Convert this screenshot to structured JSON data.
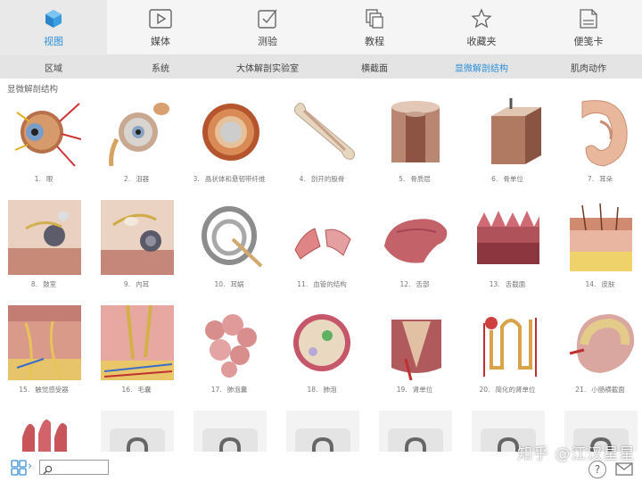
{
  "toptabs": [
    {
      "label": "视图",
      "icon": "cube-icon",
      "active": true
    },
    {
      "label": "媒体",
      "icon": "play-icon",
      "active": false
    },
    {
      "label": "测验",
      "icon": "checkbox-icon",
      "active": false
    },
    {
      "label": "教程",
      "icon": "copy-icon",
      "active": false
    },
    {
      "label": "收藏夹",
      "icon": "star-icon",
      "active": false
    },
    {
      "label": "便笺卡",
      "icon": "note-card-icon",
      "active": false
    }
  ],
  "subtabs": [
    {
      "label": "区域",
      "active": false
    },
    {
      "label": "系统",
      "active": false
    },
    {
      "label": "大体解剖实验室",
      "active": false
    },
    {
      "label": "横截面",
      "active": false
    },
    {
      "label": "显微解剖结构",
      "active": true
    },
    {
      "label": "肌肉动作",
      "active": false
    }
  ],
  "section_title": "显微解剖结构",
  "colors": {
    "accent": "#2d8fd9",
    "topbar": "#f5f5f5",
    "subnav": "#e4e4e4"
  },
  "tiles": [
    {
      "num": "1.",
      "label": "眼",
      "img": "eye"
    },
    {
      "num": "2.",
      "label": "泪器",
      "img": "lacrimal"
    },
    {
      "num": "3.",
      "label": "晶状体和悬韧带纤维",
      "img": "lens"
    },
    {
      "num": "4.",
      "label": "剖开的股骨",
      "img": "femur"
    },
    {
      "num": "5.",
      "label": "骨质层",
      "img": "bone"
    },
    {
      "num": "6.",
      "label": "骨单位",
      "img": "osteon"
    },
    {
      "num": "7.",
      "label": "耳朵",
      "img": "ear"
    },
    {
      "num": "8.",
      "label": "鼓室",
      "img": "tympanic"
    },
    {
      "num": "9.",
      "label": "内耳",
      "img": "innerear"
    },
    {
      "num": "10.",
      "label": "耳蜗",
      "img": "cochlea"
    },
    {
      "num": "11.",
      "label": "血管的结构",
      "img": "vessel"
    },
    {
      "num": "12.",
      "label": "舌部",
      "img": "tongue"
    },
    {
      "num": "13.",
      "label": "舌截面",
      "img": "tonguesec"
    },
    {
      "num": "14.",
      "label": "皮肤",
      "img": "skin"
    },
    {
      "num": "15.",
      "label": "触觉感受器",
      "img": "receptor"
    },
    {
      "num": "16.",
      "label": "毛囊",
      "img": "follicle"
    },
    {
      "num": "17.",
      "label": "肺泡囊",
      "img": "alveolar"
    },
    {
      "num": "18.",
      "label": "肺泡",
      "img": "alveolus"
    },
    {
      "num": "19.",
      "label": "肾单位",
      "img": "kidney"
    },
    {
      "num": "20.",
      "label": "简化的肾单位",
      "img": "nephron"
    },
    {
      "num": "21.",
      "label": "小肠横截面",
      "img": "intestine"
    },
    {
      "num": "",
      "label": "",
      "img": "villi"
    },
    {
      "num": "",
      "label": "",
      "img": "locked"
    },
    {
      "num": "",
      "label": "",
      "img": "locked"
    },
    {
      "num": "",
      "label": "",
      "img": "locked"
    },
    {
      "num": "",
      "label": "",
      "img": "locked"
    },
    {
      "num": "",
      "label": "",
      "img": "locked"
    },
    {
      "num": "",
      "label": "",
      "img": "locked"
    }
  ],
  "bottom": {
    "search_placeholder": "",
    "search_value": "",
    "help_label": "?"
  },
  "watermark": "知乎 @江汉星星"
}
